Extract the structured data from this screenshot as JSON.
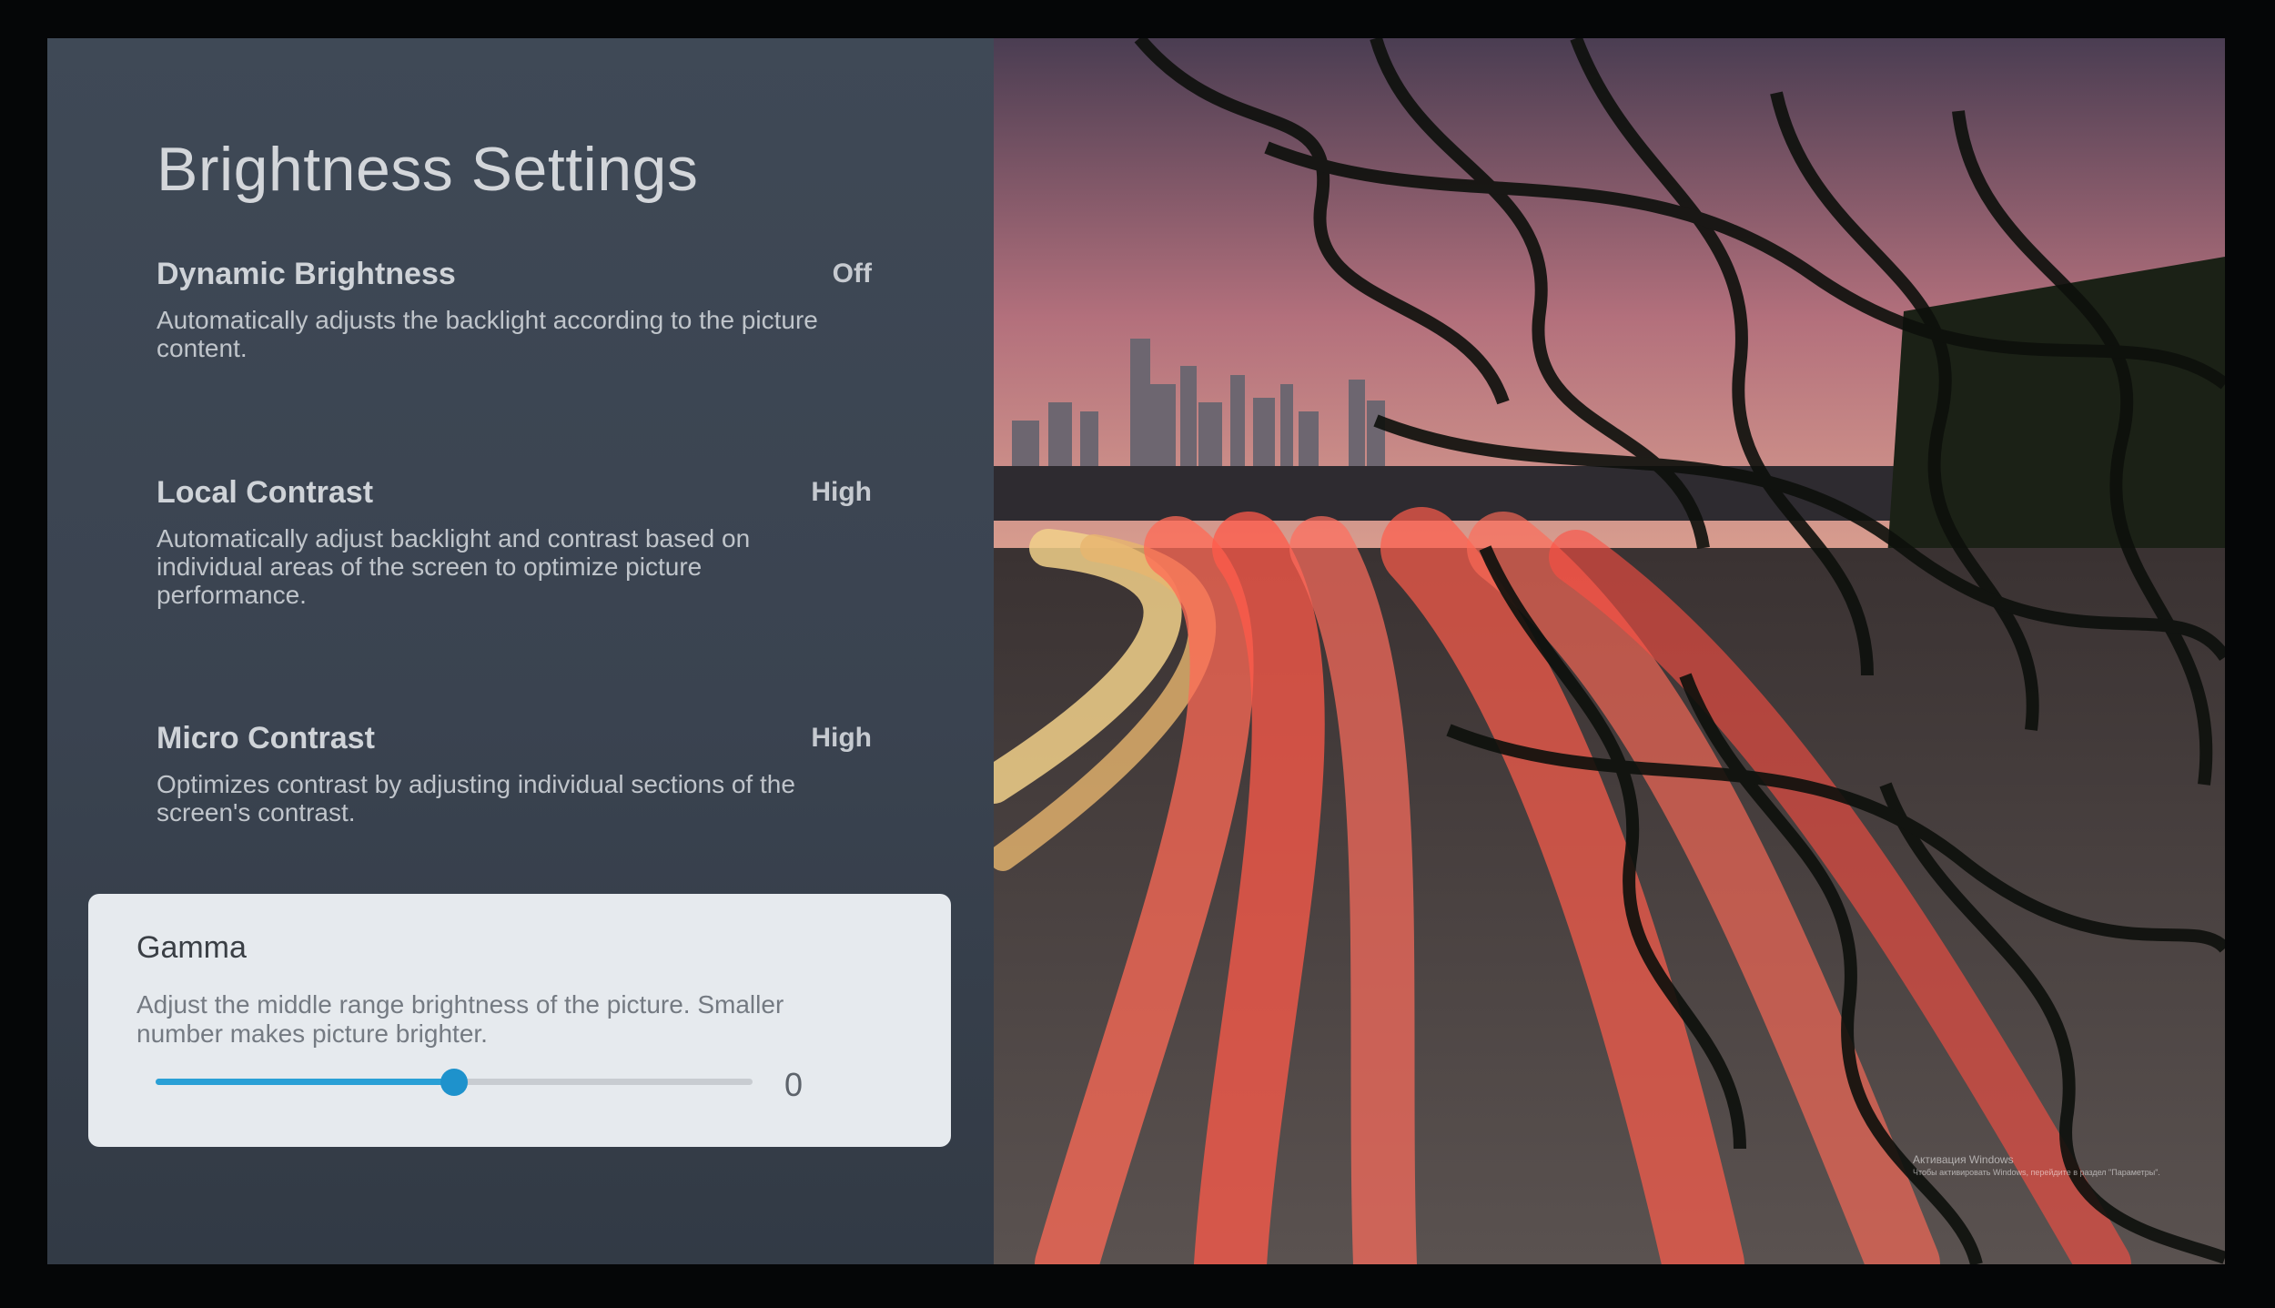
{
  "settings": {
    "title": "Brightness Settings",
    "items": [
      {
        "name": "Dynamic Brightness",
        "value": "Off",
        "description": "Automatically adjusts the backlight according to the picture content."
      },
      {
        "name": "Local Contrast",
        "value": "High",
        "description": "Automatically adjust backlight and contrast based on individual areas of the screen to optimize picture performance."
      },
      {
        "name": "Micro Contrast",
        "value": "High",
        "description": "Optimizes contrast by adjusting individual sections of the screen's contrast."
      }
    ],
    "gamma": {
      "name": "Gamma",
      "description": "Adjust the middle range brightness of the picture. Smaller number makes picture brighter.",
      "value": "0",
      "slider_fraction": 0.5
    }
  },
  "watermark": {
    "title": "Активация Windows",
    "subtitle": "Чтобы активировать Windows, перейдите в раздел \"Параметры\"."
  },
  "colors": {
    "accent": "#2aa0d6",
    "panel": "#3d4653",
    "card": "#e6eaee"
  }
}
